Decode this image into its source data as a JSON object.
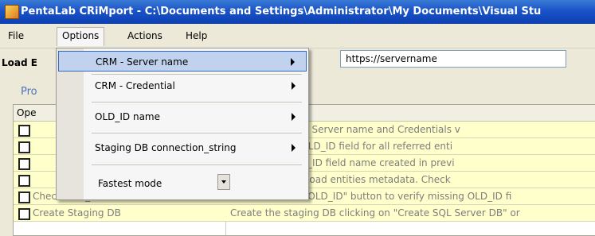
{
  "window": {
    "title": "PentaLab CRiMport - C:\\Documents and Settings\\Administrator\\My Documents\\Visual Stu"
  },
  "menubar": {
    "items": [
      {
        "label": "File"
      },
      {
        "label": "Options"
      },
      {
        "label": "Actions"
      },
      {
        "label": "Help"
      }
    ]
  },
  "toolbar": {
    "load_label": "Load E",
    "server_url": "https://servername"
  },
  "tab": {
    "label": "Pro"
  },
  "grid": {
    "header": "Ope",
    "rows": [
      {
        "operation": "",
        "description": "n menu set CRM Server name and Credentials v"
      },
      {
        "operation": "",
        "description": "Server add an OLD_ID field for all referred enti"
      },
      {
        "operation": "",
        "description": "n menu set OLD_ID field name created in previ"
      },
      {
        "operation": "",
        "description": "ntity\" button to load entities metadata. Check"
      },
      {
        "operation": "Check OLD_ID",
        "description": "Click on \"Check OLD_ID\" button to verify missing OLD_ID fi"
      },
      {
        "operation": "Create Staging DB",
        "description": "Create the staging DB clicking on \"Create SQL Server DB\" or"
      }
    ]
  },
  "options_menu": {
    "items": [
      {
        "label": "CRM - Server name"
      },
      {
        "label": "CRM - Credential"
      },
      {
        "label": "OLD_ID name"
      },
      {
        "label": "Staging DB connection_string"
      }
    ],
    "mode": "Fastest mode"
  }
}
